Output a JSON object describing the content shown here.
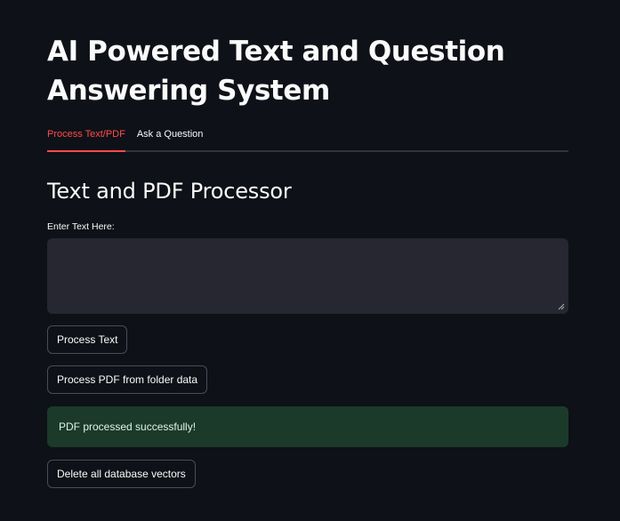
{
  "app": {
    "title_line1": "AI Powered Text and Question",
    "title_line2": "Answering System"
  },
  "tabs": [
    {
      "label": "Process Text/PDF",
      "active": true
    },
    {
      "label": "Ask a Question",
      "active": false
    }
  ],
  "section": {
    "title": "Text and PDF Processor"
  },
  "text_input": {
    "label": "Enter Text Here:",
    "value": ""
  },
  "buttons": {
    "process_text": "Process Text",
    "process_pdf": "Process PDF from folder data",
    "delete_vectors": "Delete all database vectors"
  },
  "alert": {
    "message": "PDF processed successfully!",
    "type": "success"
  },
  "colors": {
    "background": "#0e1117",
    "accent": "#ff4b4b",
    "input_bg": "#262730",
    "success_bg": "#1b3a2a"
  }
}
